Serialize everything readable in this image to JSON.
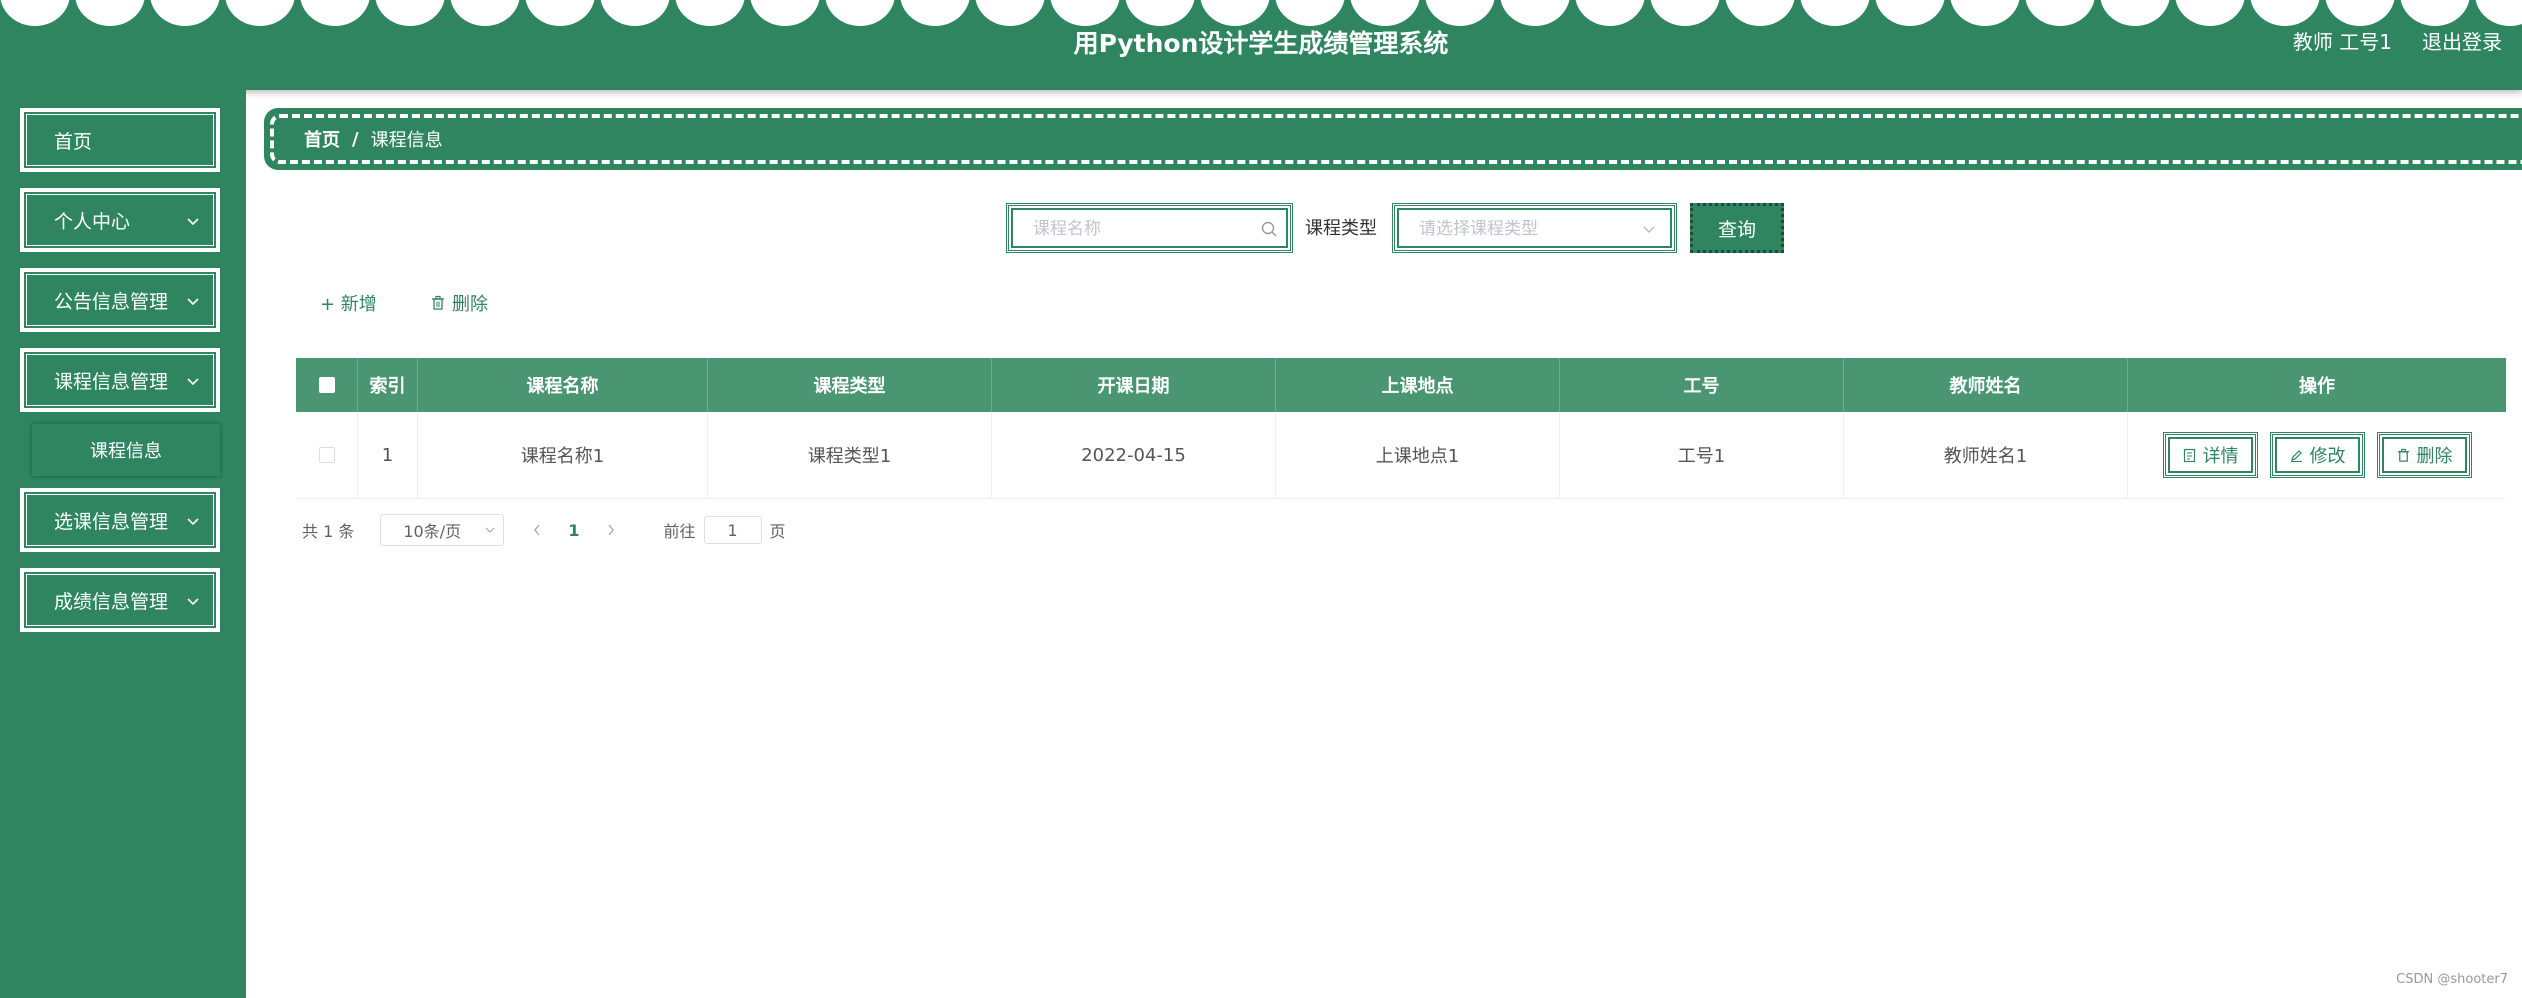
{
  "header": {
    "title": "用Python设计学生成绩管理系统",
    "user_label": "教师 工号1",
    "logout_label": "退出登录"
  },
  "sidebar": {
    "items": [
      {
        "label": "首页"
      },
      {
        "label": "个人中心"
      },
      {
        "label": "公告信息管理"
      },
      {
        "label": "课程信息管理"
      },
      {
        "label": "选课信息管理"
      },
      {
        "label": "成绩信息管理"
      }
    ],
    "submenu": {
      "label": "课程信息"
    }
  },
  "breadcrumb": {
    "home": "首页",
    "separator": "/",
    "current": "课程信息"
  },
  "search": {
    "name_placeholder": "课程名称",
    "type_label": "课程类型",
    "type_placeholder": "请选择课程类型",
    "query_label": "查询"
  },
  "toolbar": {
    "add_label": "+ 新增",
    "delete_label": "删除"
  },
  "table": {
    "headers": [
      "索引",
      "课程名称",
      "课程类型",
      "开课日期",
      "上课地点",
      "工号",
      "教师姓名",
      "操作"
    ],
    "rows": [
      {
        "index": "1",
        "name": "课程名称1",
        "type": "课程类型1",
        "date": "2022-04-15",
        "location": "上课地点1",
        "teacher_id": "工号1",
        "teacher_name": "教师姓名1"
      }
    ],
    "actions": {
      "detail": "详情",
      "edit": "修改",
      "delete": "删除"
    }
  },
  "pagination": {
    "total": "共 1 条",
    "page_size": "10条/页",
    "current_page": "1",
    "goto_label": "前往",
    "goto_value": "1",
    "goto_suffix": "页"
  },
  "watermark": "CSDN @shooter7",
  "colors": {
    "primary": "#2e8560",
    "header_row": "#4a9672"
  }
}
